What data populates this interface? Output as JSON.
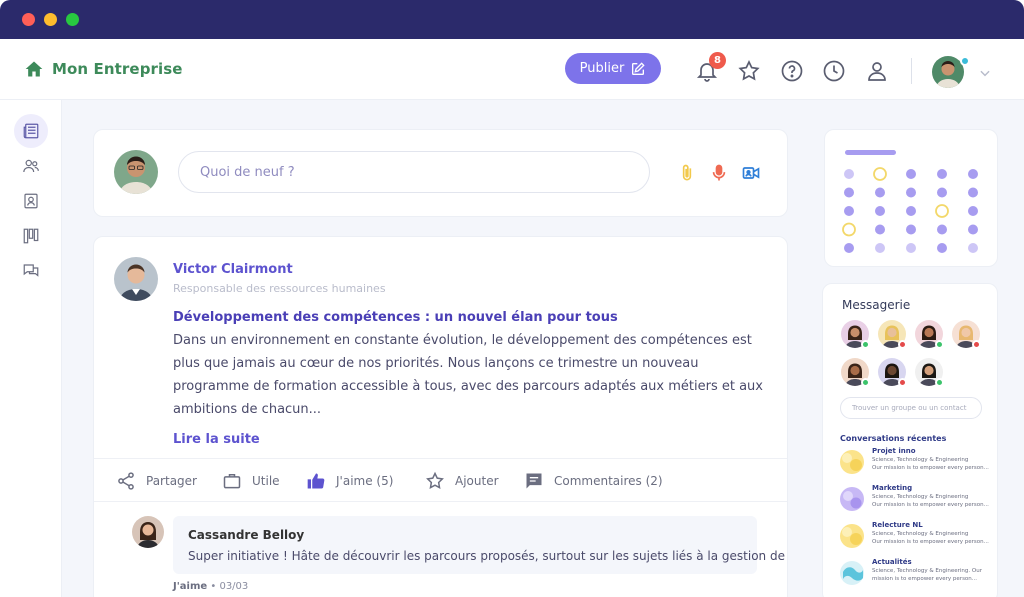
{
  "window": {
    "controls": [
      "close",
      "minimize",
      "maximize"
    ]
  },
  "topbar": {
    "brand": "Mon Entreprise",
    "brand_icon": "home-icon",
    "publish_label": "Publier",
    "notifications_count": "8",
    "icons": [
      "bell-icon",
      "star-icon",
      "help-icon",
      "clock-icon",
      "user-icon",
      "chevron-down-icon"
    ]
  },
  "sidebar": {
    "items": [
      {
        "icon": "newspaper-icon",
        "active": true
      },
      {
        "icon": "users-icon",
        "active": false
      },
      {
        "icon": "contact-card-icon",
        "active": false
      },
      {
        "icon": "kanban-icon",
        "active": false
      },
      {
        "icon": "chat-icon",
        "active": false
      }
    ]
  },
  "composer": {
    "placeholder": "Quoi de neuf ?",
    "icons": [
      "paperclip-icon",
      "microphone-icon",
      "video-camera-icon"
    ]
  },
  "post": {
    "author": "Victor Clairmont",
    "role": "Responsable des ressources humaines",
    "title": "Développement des compétences : un nouvel élan pour tous",
    "body": "Dans un environnement en constante évolution, le développement des compétences est plus que jamais au cœur de nos priorités. Nous lançons ce trimestre un nouveau programme de formation accessible à tous, avec des parcours adaptés aux métiers et aux ambitions de chacun...",
    "read_more": "Lire la suite",
    "actions": {
      "share": "Partager",
      "useful": "Utile",
      "like": "J'aime (5)",
      "add": "Ajouter",
      "comments": "Commentaires (2)"
    },
    "comment": {
      "author": "Cassandre Belloy",
      "text": "Super initiative ! Hâte de découvrir les parcours proposés, surtout sur les sujets liés à la gestion de projet",
      "like": "J'aime",
      "separator": "•",
      "date": "03/03"
    }
  },
  "messenger": {
    "title": "Messagerie",
    "search_placeholder": "Trouver un groupe ou un contact",
    "recent_title": "Conversations récentes",
    "contacts": [
      {
        "status": "online"
      },
      {
        "status": "busy"
      },
      {
        "status": "online"
      },
      {
        "status": "busy"
      },
      {
        "status": "online"
      },
      {
        "status": "busy"
      },
      {
        "status": "online"
      }
    ],
    "conversations": [
      {
        "name": "Projet inno",
        "category": "Science, Technology & Engineering",
        "desc": "Our mission is to empower every person...",
        "color": "#fbe38a"
      },
      {
        "name": "Marketing",
        "category": "Science, Technology & Engineering",
        "desc": "Our mission is to empower every person...",
        "color": "#c7b8f5"
      },
      {
        "name": "Relecture NL",
        "category": "Science, Technology & Engineering",
        "desc": "Our mission is to empower every person...",
        "color": "#fbe38a"
      },
      {
        "name": "Actualités",
        "category": "Science, Technology & Engineering. Our",
        "desc": "mission is to empower every person...",
        "color": "#5cc4dc"
      }
    ]
  },
  "colors": {
    "accent": "#7d73ea",
    "brand": "#3d8a5a",
    "titlebar": "#2b2a6b",
    "online": "#3cc36b",
    "busy": "#e44a4a"
  }
}
